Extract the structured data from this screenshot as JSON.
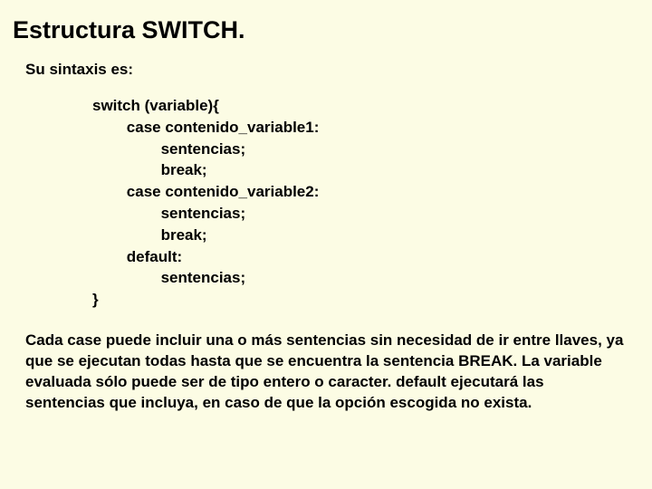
{
  "title": "Estructura SWITCH.",
  "intro": "Su sintaxis es:",
  "code": "switch (variable){\n        case contenido_variable1:\n                sentencias;\n                break;\n        case contenido_variable2:\n                sentencias;\n                break;\n        default:\n                sentencias;\n}",
  "paragraph": "Cada case puede incluir una o más sentencias sin necesidad de ir entre llaves, ya que se ejecutan todas hasta que se encuentra la sentencia BREAK. La variable evaluada sólo puede ser de tipo entero o caracter. default ejecutará las sentencias que incluya, en caso de que la opción escogida no exista."
}
